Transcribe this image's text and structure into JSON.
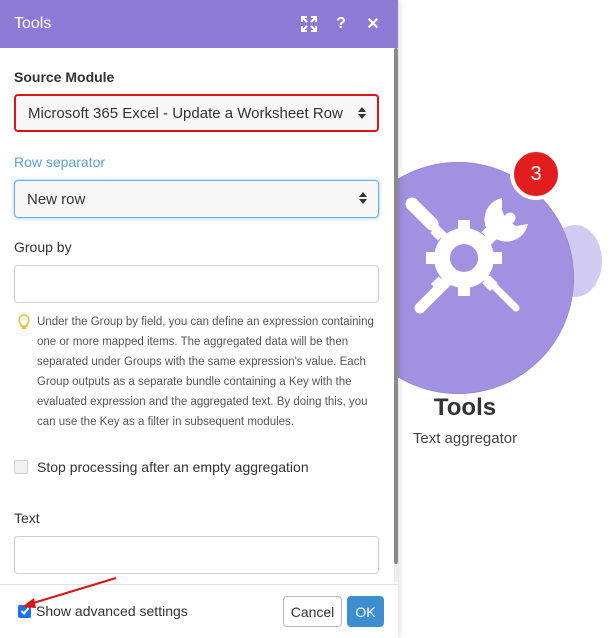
{
  "panel": {
    "title": "Tools",
    "header_icons": [
      "expand-icon",
      "help-icon",
      "close-icon"
    ],
    "header_color": "#8c7bd6"
  },
  "form": {
    "source_module": {
      "label": "Source Module",
      "value": "Microsoft 365 Excel - Update a Worksheet Row"
    },
    "row_separator": {
      "label": "Row separator",
      "value": "New row"
    },
    "group_by": {
      "label": "Group by",
      "value": "",
      "hint": "Under the Group by field, you can define an expression containing one or more mapped items. The aggregated data will be then separated under Groups with the same expression's value. Each Group outputs as a separate bundle containing a Key with the evaluated expression and the aggregated text. By doing this, you can use the Key as a filter in subsequent modules."
    },
    "stop_processing": {
      "label": "Stop processing after an empty aggregation",
      "checked": false
    },
    "text": {
      "label": "Text",
      "value": ""
    }
  },
  "footer": {
    "advanced_label": "Show advanced settings",
    "advanced_checked": true,
    "cancel_label": "Cancel",
    "ok_label": "OK"
  },
  "module": {
    "name": "Tools",
    "subtitle": "Text aggregator",
    "badge": "3",
    "icon": "tools-icon",
    "color": "#a191e0",
    "badge_color": "#e31d1d"
  },
  "colors": {
    "highlight_border": "#d91515",
    "annotation_arrow": "#d91515",
    "ok_button": "#3d8ed0",
    "link_label": "#5aa0d6"
  }
}
